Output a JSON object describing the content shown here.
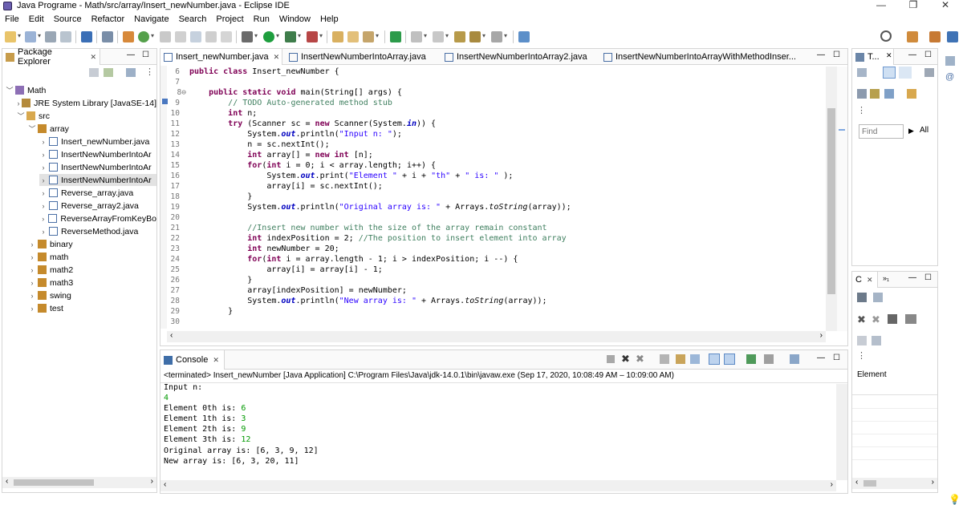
{
  "window": {
    "title": "Java Programe - Math/src/array/Insert_newNumber.java - Eclipse IDE",
    "minimize": "—",
    "maximize": "❐",
    "close": "✕"
  },
  "menu": [
    "File",
    "Edit",
    "Source",
    "Refactor",
    "Navigate",
    "Search",
    "Project",
    "Run",
    "Window",
    "Help"
  ],
  "package_explorer": {
    "title": "Package Explorer",
    "tree": [
      {
        "label": "Math",
        "level": 0,
        "arrow": "﹀",
        "icon": "project-icon"
      },
      {
        "label": "JRE System Library [JavaSE-14]",
        "level": 1,
        "arrow": "›",
        "icon": "library-icon"
      },
      {
        "label": "src",
        "level": 1,
        "arrow": "﹀",
        "icon": "source-folder-icon"
      },
      {
        "label": "array",
        "level": 2,
        "arrow": "﹀",
        "icon": "package-icon"
      },
      {
        "label": "Insert_newNumber.java",
        "level": 3,
        "arrow": "›",
        "icon": "java-file-icon"
      },
      {
        "label": "InsertNewNumberIntoAr",
        "level": 3,
        "arrow": "›",
        "icon": "java-file-icon"
      },
      {
        "label": "InsertNewNumberIntoAr",
        "level": 3,
        "arrow": "›",
        "icon": "java-file-icon"
      },
      {
        "label": "InsertNewNumberIntoAr",
        "level": 3,
        "arrow": "›",
        "icon": "java-file-icon",
        "selected": true
      },
      {
        "label": "Reverse_array.java",
        "level": 3,
        "arrow": "›",
        "icon": "java-file-icon"
      },
      {
        "label": "Reverse_array2.java",
        "level": 3,
        "arrow": "›",
        "icon": "java-file-icon"
      },
      {
        "label": "ReverseArrayFromKeyBo",
        "level": 3,
        "arrow": "›",
        "icon": "java-file-icon"
      },
      {
        "label": "ReverseMethod.java",
        "level": 3,
        "arrow": "›",
        "icon": "java-file-icon"
      },
      {
        "label": "binary",
        "level": 2,
        "arrow": "›",
        "icon": "package-icon"
      },
      {
        "label": "math",
        "level": 2,
        "arrow": "›",
        "icon": "package-icon"
      },
      {
        "label": "math2",
        "level": 2,
        "arrow": "›",
        "icon": "package-icon"
      },
      {
        "label": "math3",
        "level": 2,
        "arrow": "›",
        "icon": "package-icon"
      },
      {
        "label": "swing",
        "level": 2,
        "arrow": "›",
        "icon": "package-icon"
      },
      {
        "label": "test",
        "level": 2,
        "arrow": "›",
        "icon": "package-icon"
      }
    ]
  },
  "editor": {
    "tabs": [
      {
        "label": "Insert_newNumber.java",
        "active": true
      },
      {
        "label": "InsertNewNumberIntoArray.java"
      },
      {
        "label": "InsertNewNumberIntoArray2.java"
      },
      {
        "label": "InsertNewNumberIntoArrayWithMethodInser..."
      }
    ],
    "line_numbers": [
      "6",
      "7",
      "8⊖",
      "9",
      "10",
      "11",
      "12",
      "13",
      "14",
      "15",
      "16",
      "17",
      "18",
      "19",
      "20",
      "21",
      "22",
      "23",
      "24",
      "25",
      "26",
      "27",
      "28",
      "29",
      "30"
    ],
    "lines": [
      "public class Insert_newNumber {",
      "",
      "    public static void main(String[] args) {",
      "        // TODO Auto-generated method stub",
      "        int n;",
      "        try (Scanner sc = new Scanner(System.in)) {",
      "            System.out.println(\"Input n: \");",
      "            n = sc.nextInt();",
      "            int array[] = new int [n];",
      "            for(int i = 0; i < array.length; i++) {",
      "                System.out.print(\"Element \" + i + \"th\" + \" is: \" );",
      "                array[i] = sc.nextInt();",
      "            }",
      "            System.out.println(\"Original array is: \" + Arrays.toString(array));",
      "",
      "            //Insert new number with the size of the array remain constant",
      "            int indexPosition = 2; //The position to insert element into array",
      "            int newNumber = 20;",
      "            for(int i = array.length - 1; i > indexPosition; i --) {",
      "                array[i] = array[i] - 1;",
      "            }",
      "            array[indexPosition] = newNumber;",
      "            System.out.println(\"New array is: \" + Arrays.toString(array));",
      "        }",
      ""
    ]
  },
  "console": {
    "title": "Console",
    "status": "<terminated> Insert_newNumber [Java Application] C:\\Program Files\\Java\\jdk-14.0.1\\bin\\javaw.exe  (Sep 17, 2020, 10:08:49 AM – 10:09:00 AM)",
    "output": [
      {
        "prefix": "Input n:",
        "input": ""
      },
      {
        "prefix": "",
        "input": "4"
      },
      {
        "prefix": "Element 0th is: ",
        "input": "6"
      },
      {
        "prefix": "Element 1th is: ",
        "input": "3"
      },
      {
        "prefix": "Element 2th is: ",
        "input": "9"
      },
      {
        "prefix": "Element 3th is: ",
        "input": "12"
      },
      {
        "prefix": "Original array is: [6, 3, 9, 12]",
        "input": ""
      },
      {
        "prefix": "New array is: [6, 3, 20, 11]",
        "input": ""
      }
    ]
  },
  "right_panels": {
    "outline_tab": "T...",
    "find_placeholder": "Find",
    "find_all": "All",
    "bottom_tab": "C",
    "element_label": "Element"
  },
  "colors": {
    "keyword": "#7f0055",
    "comment": "#3f7f5f",
    "string": "#2a00ff",
    "field": "#0000c0",
    "user_input": "#009900",
    "selection": "#e2e2e2"
  }
}
